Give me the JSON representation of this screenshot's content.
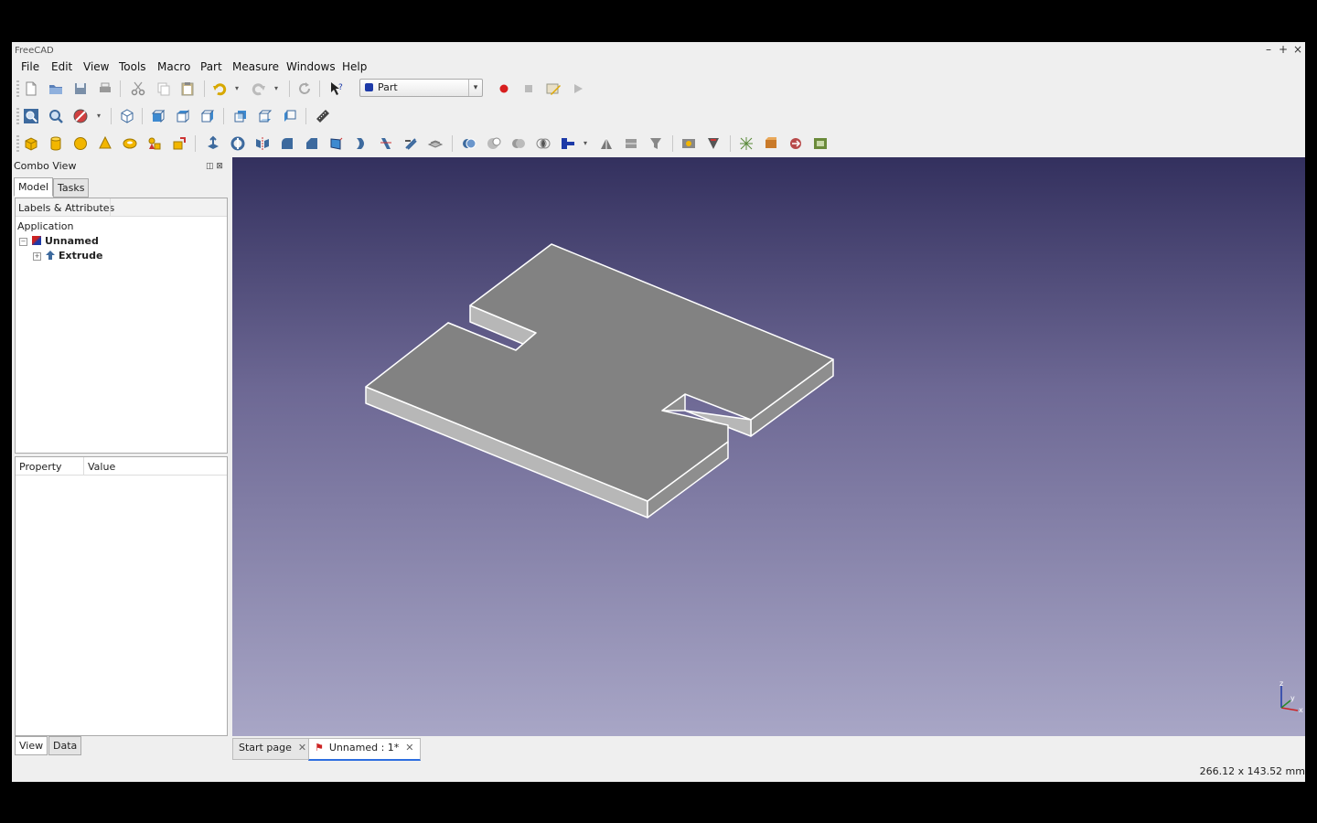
{
  "window": {
    "title": "FreeCAD"
  },
  "menu": [
    "File",
    "Edit",
    "View",
    "Tools",
    "Macro",
    "Part",
    "Measure",
    "Windows",
    "Help"
  ],
  "workbench": {
    "selected": "Part"
  },
  "combo": {
    "title": "Combo View",
    "tabs": [
      "Model",
      "Tasks"
    ],
    "tree_header": "Labels & Attributes",
    "root": "Application",
    "doc": "Unnamed",
    "object": "Extrude",
    "prop_headers": [
      "Property",
      "Value"
    ],
    "bottom_tabs": [
      "View",
      "Data"
    ]
  },
  "doc_tabs": [
    {
      "label": "Start page"
    },
    {
      "label": "Unnamed : 1*"
    }
  ],
  "axis": {
    "x": "x",
    "y": "y",
    "z": "z"
  },
  "status": "266.12 x 143.52 mm"
}
